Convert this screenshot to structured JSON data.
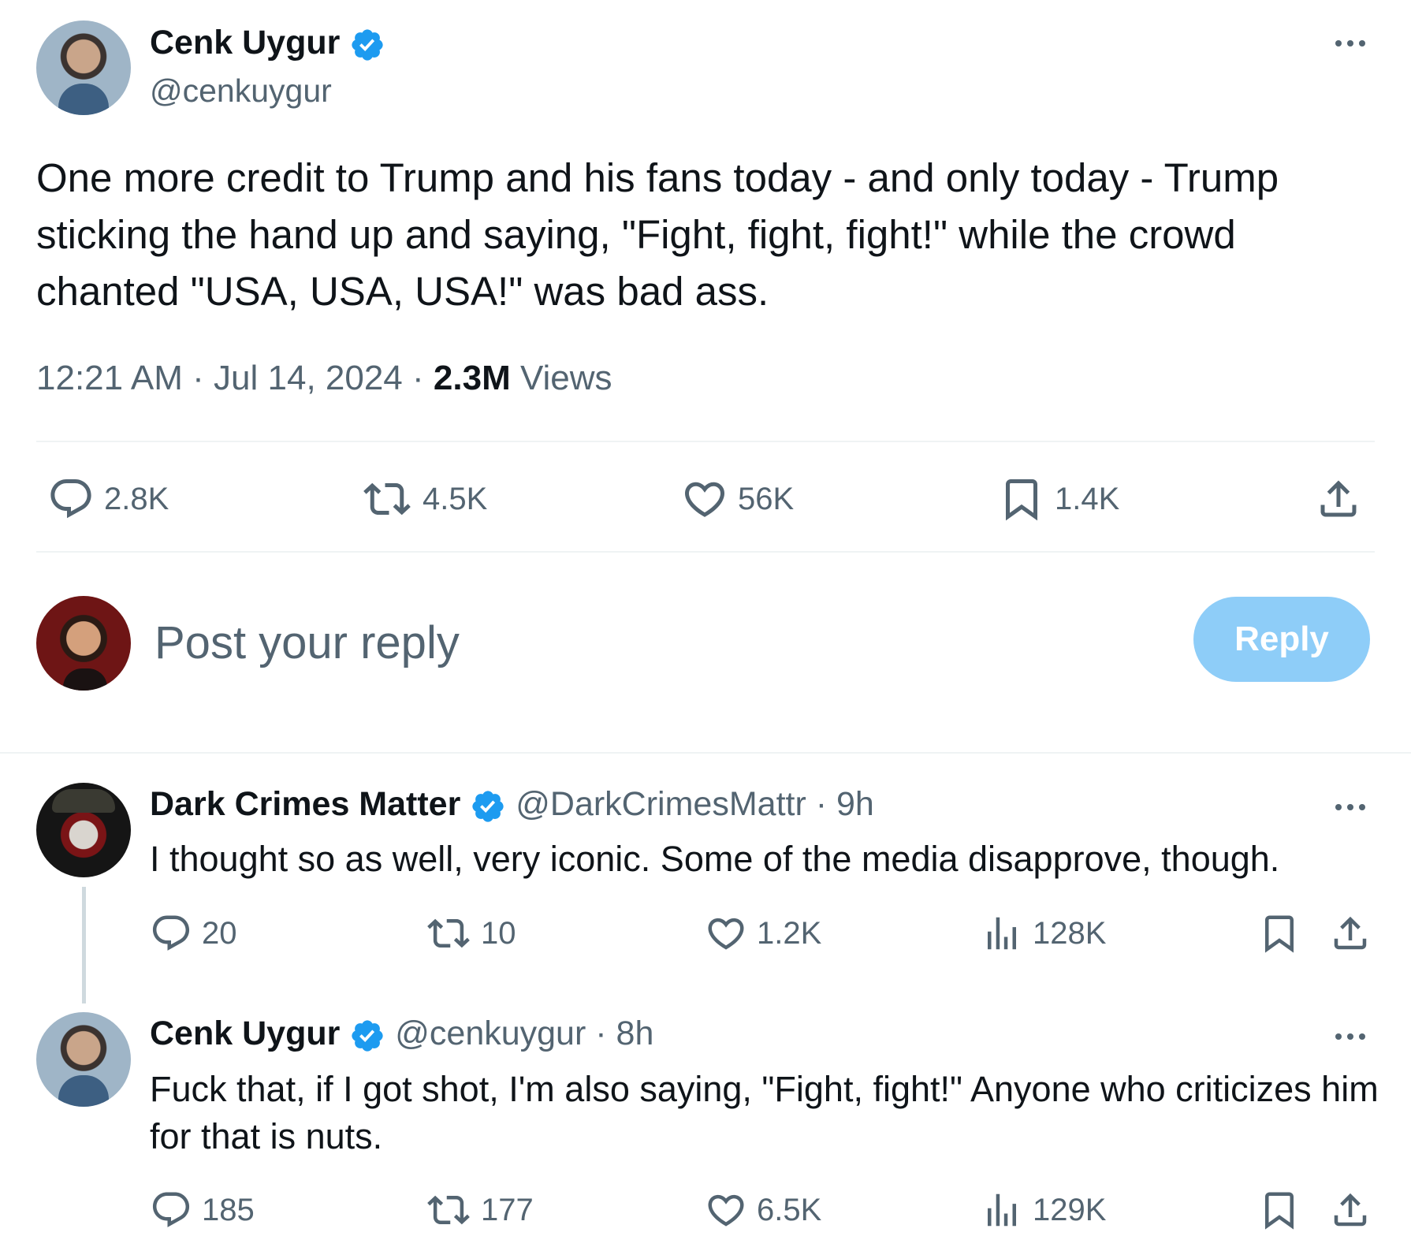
{
  "main_tweet": {
    "author_name": "Cenk Uygur",
    "handle": "@cenkuygur",
    "text": "One more credit to Trump and his fans today - and only today - Trump sticking the hand up and saying, \"Fight, fight, fight!\" while the crowd chanted \"USA, USA, USA!\" was bad ass.",
    "time": "12:21 AM",
    "separator": "·",
    "date": "Jul 14, 2024",
    "views_count": "2.3M",
    "views_label": "Views",
    "actions": {
      "replies": "2.8K",
      "reposts": "4.5K",
      "likes": "56K",
      "bookmarks": "1.4K"
    }
  },
  "composer": {
    "placeholder": "Post your reply",
    "button_label": "Reply"
  },
  "replies": [
    {
      "author_name": "Dark Crimes Matter",
      "handle": "@DarkCrimesMattr",
      "separator": "·",
      "time_ago": "9h",
      "text": "I thought so as well, very iconic.  Some of the media disapprove, though.",
      "replies": "20",
      "reposts": "10",
      "likes": "1.2K",
      "views": "128K"
    },
    {
      "author_name": "Cenk Uygur",
      "handle": "@cenkuygur",
      "separator": "·",
      "time_ago": "8h",
      "text": "Fuck that, if I got shot, I'm also saying, \"Fight, fight!\" Anyone who criticizes him for that is nuts.",
      "replies": "185",
      "reposts": "177",
      "likes": "6.5K",
      "views": "129K"
    }
  ],
  "colors": {
    "accent": "#1d9bf0",
    "reply_button_disabled": "#8ecdf8",
    "text_primary": "#0f1419",
    "text_secondary": "#536471",
    "divider": "#eff3f4"
  },
  "icons": [
    "verified-badge-icon",
    "more-icon",
    "reply-icon",
    "repost-icon",
    "like-icon",
    "bookmark-icon",
    "share-icon",
    "views-icon"
  ]
}
